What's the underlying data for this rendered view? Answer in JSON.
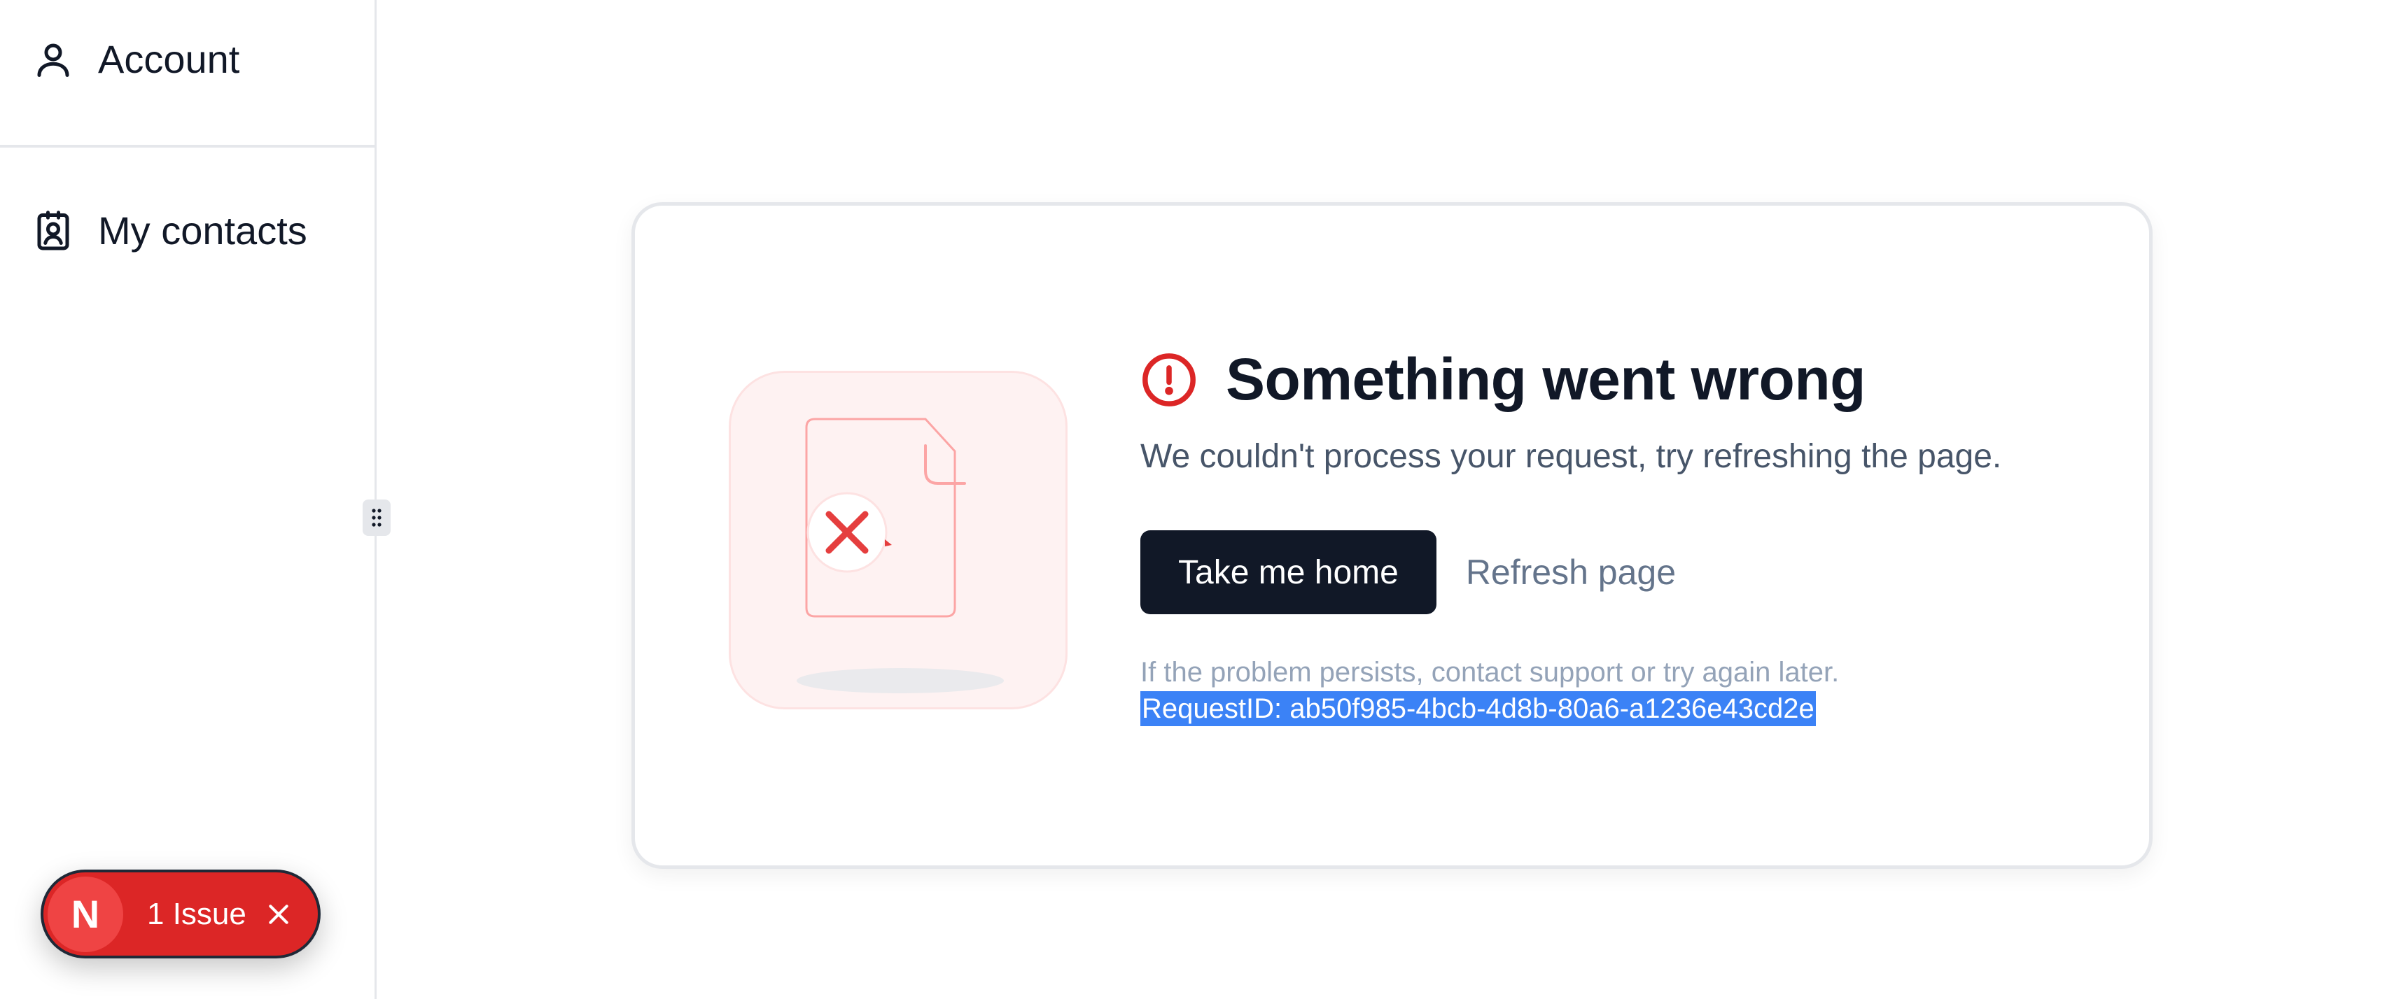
{
  "sidebar": {
    "items": [
      {
        "label": "Account",
        "icon": "user-icon"
      },
      {
        "label": "My contacts",
        "icon": "contact-card-icon"
      }
    ]
  },
  "issues": {
    "badge_letter": "N",
    "label": "1 Issue"
  },
  "error": {
    "title": "Something went wrong",
    "message": "We couldn't process your request, try refreshing the page.",
    "primary_action": "Take me home",
    "secondary_action": "Refresh page",
    "help_text": "If the problem persists, contact support or try again later.",
    "request_id": "RequestID: ab50f985-4bcb-4d8b-80a6-a1236e43cd2e"
  },
  "colors": {
    "accent_dark": "#111827",
    "error_red": "#dc2626",
    "selection_blue": "#3b82f6"
  }
}
